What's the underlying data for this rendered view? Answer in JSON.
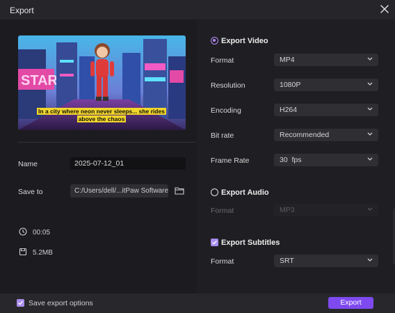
{
  "window": {
    "title": "Export"
  },
  "preview": {
    "caption": "In a city where neon never sleeps... she rides above the chaos"
  },
  "form": {
    "name_label": "Name",
    "name_value": "2025-07-12_01",
    "save_to_label": "Save to",
    "save_to_value": "C:/Users/dell/...itPaw Software"
  },
  "meta": {
    "duration": "00:05",
    "size": "5.2MB"
  },
  "video": {
    "section_label": "Export Video",
    "selected": true,
    "fields": [
      {
        "label": "Format",
        "value": "MP4"
      },
      {
        "label": "Resolution",
        "value": "1080P"
      },
      {
        "label": "Encoding",
        "value": "H264"
      },
      {
        "label": "Bit rate",
        "value": "Recommended"
      },
      {
        "label": "Frame Rate",
        "value": "30  fps"
      }
    ]
  },
  "audio": {
    "section_label": "Export Audio",
    "selected": false,
    "fields": [
      {
        "label": "Format",
        "value": "MP3",
        "disabled": true
      }
    ]
  },
  "subtitles": {
    "section_label": "Export Subtitles",
    "checked": true,
    "fields": [
      {
        "label": "Format",
        "value": "SRT"
      }
    ]
  },
  "footer": {
    "save_options_label": "Save export options",
    "save_options_checked": true,
    "export_label": "Export"
  },
  "colors": {
    "accent": "#7e4af0",
    "radio_active": "#b58cf5",
    "background": "#1f1f23",
    "caption_bg": "#f3d62a"
  }
}
